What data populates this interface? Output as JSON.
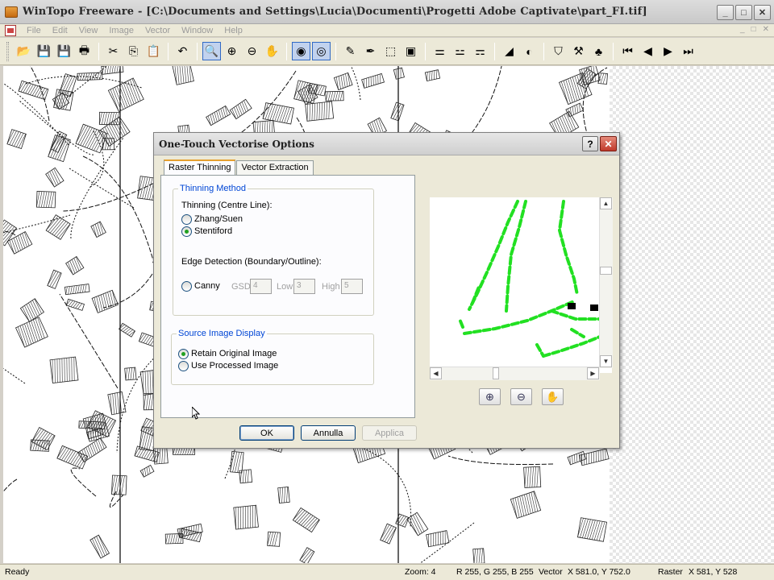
{
  "window": {
    "title": "WinTopo Freeware - [C:\\Documents and Settings\\Lucia\\Documenti\\Progetti Adobe Captivate\\part_FI.tif]",
    "controls": {
      "minimize": "_",
      "maximize": "□",
      "close": "✕"
    }
  },
  "menu": {
    "items": [
      "File",
      "Edit",
      "View",
      "Image",
      "Vector",
      "Window",
      "Help"
    ],
    "right": [
      "_",
      "□",
      "✕"
    ]
  },
  "toolbar": {
    "buttons": [
      {
        "icon": "open-folder-icon",
        "glyph": "📂"
      },
      {
        "icon": "save-icon",
        "glyph": "💾"
      },
      {
        "icon": "save-as-icon",
        "glyph": "💾"
      },
      {
        "icon": "print-icon",
        "glyph": "🖶"
      },
      {
        "icon": "cut-icon",
        "glyph": "✂"
      },
      {
        "icon": "copy-icon",
        "glyph": "⎘"
      },
      {
        "icon": "paste-icon",
        "glyph": "📋"
      },
      {
        "icon": "undo-icon",
        "glyph": "↶"
      },
      {
        "icon": "zoom-icon",
        "glyph": "🔍"
      },
      {
        "icon": "zoom-in-icon",
        "glyph": "⊕"
      },
      {
        "icon": "zoom-out-icon",
        "glyph": "⊖"
      },
      {
        "icon": "pan-hand-icon",
        "glyph": "✋"
      },
      {
        "icon": "raster-view-icon",
        "glyph": "◉"
      },
      {
        "icon": "vector-view-icon",
        "glyph": "◎"
      },
      {
        "icon": "pencil-icon",
        "glyph": "✎"
      },
      {
        "icon": "pen-icon",
        "glyph": "✒"
      },
      {
        "icon": "edit-tool-icon",
        "glyph": "⬚"
      },
      {
        "icon": "select-tool-icon",
        "glyph": "▣"
      },
      {
        "icon": "thinning-icon",
        "glyph": "⚌"
      },
      {
        "icon": "threshold-icon",
        "glyph": "⚍"
      },
      {
        "icon": "filter-icon",
        "glyph": "⚎"
      },
      {
        "icon": "vectorise-icon",
        "glyph": "◢"
      },
      {
        "icon": "one-touch-icon",
        "glyph": "◐"
      },
      {
        "icon": "shield-icon",
        "glyph": "⛉"
      },
      {
        "icon": "tools-icon",
        "glyph": "⚒"
      },
      {
        "icon": "tree-icon",
        "glyph": "♣"
      },
      {
        "icon": "first-page-icon",
        "glyph": "⏮"
      },
      {
        "icon": "prev-page-icon",
        "glyph": "◀"
      },
      {
        "icon": "next-page-icon",
        "glyph": "▶"
      },
      {
        "icon": "last-page-icon",
        "glyph": "⏭"
      }
    ]
  },
  "dialog": {
    "title": "One-Touch Vectorise Options",
    "help": "?",
    "close": "✕",
    "tabs": [
      "Raster Thinning",
      "Vector Extraction"
    ],
    "thinning_group": "Thinning Method",
    "centre_line_label": "Thinning (Centre Line):",
    "zhang_suen": "Zhang/Suen",
    "stentiford": "Stentiford",
    "edge_label": "Edge Detection (Boundary/Outline):",
    "canny": "Canny",
    "gsd_label": "GSD",
    "gsd_value": "4",
    "low_label": "Low",
    "low_value": "3",
    "high_label": "High",
    "high_value": "5",
    "source_group": "Source Image Display",
    "retain": "Retain Original Image",
    "processed": "Use Processed Image",
    "ok": "OK",
    "cancel": "Annulla",
    "apply": "Applica",
    "selected_thinning": "Stentiford",
    "selected_display": "Retain Original Image"
  },
  "statusbar": {
    "ready": "Ready",
    "zoom": "Zoom: 4",
    "rgb": "R 255, G 255, B 255",
    "vector_label": "Vector",
    "vector_coords": "X 581.0, Y 752.0",
    "raster_label": "Raster",
    "raster_coords": "X 581, Y 528"
  },
  "colors": {
    "preview_line": "#22e022",
    "legend_blue": "#0046d5"
  }
}
